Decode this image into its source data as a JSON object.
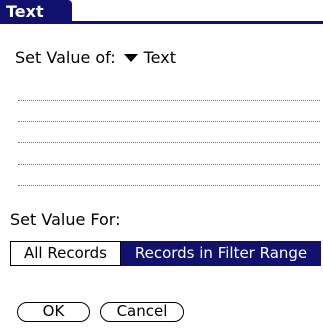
{
  "title": "Text",
  "set_value_of": {
    "label": "Set Value of:",
    "selected": "Text",
    "icon": "triangle-down-icon"
  },
  "set_value_for": {
    "label": "Set Value For:",
    "options": [
      "All Records",
      "Records in Filter Range"
    ],
    "selected_index": 1
  },
  "buttons": {
    "ok": "OK",
    "cancel": "Cancel"
  },
  "colors": {
    "accent": "#10106f",
    "background": "#ffffff"
  }
}
